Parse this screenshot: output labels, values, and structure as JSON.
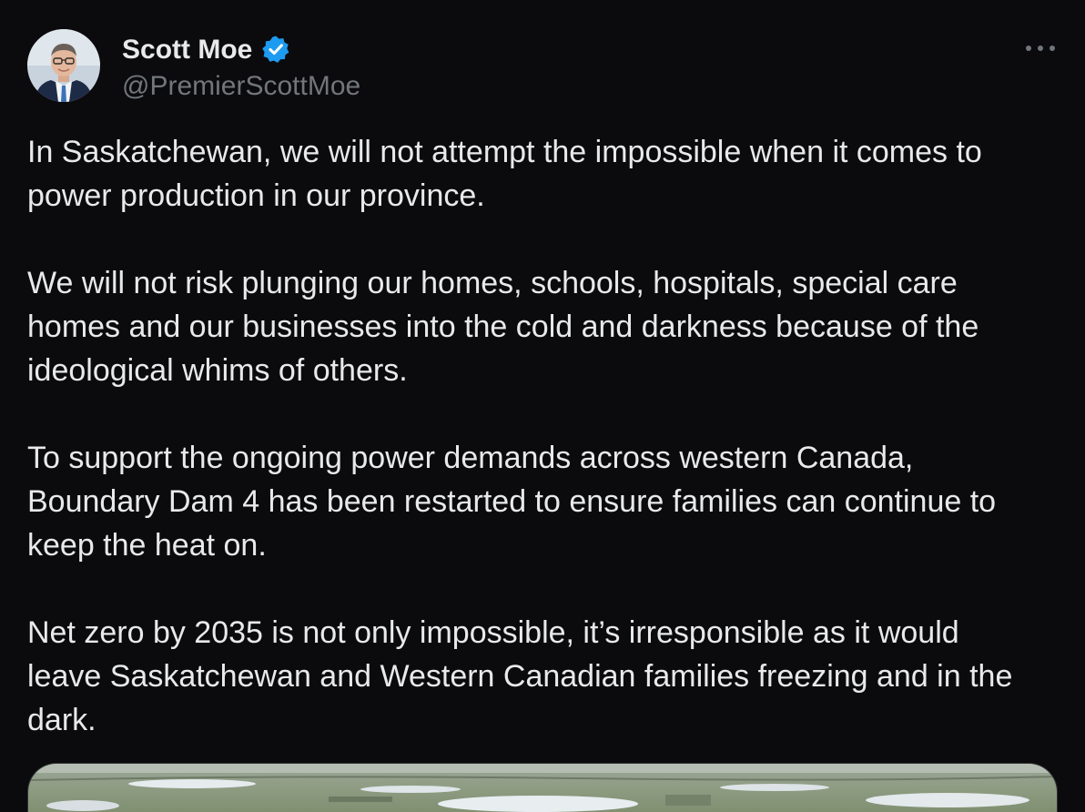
{
  "colors": {
    "background": "#0b0a0c",
    "text": "#e7e9ea",
    "secondary_text": "#71767b",
    "verified_blue": "#1d9bf0",
    "border": "#2f3336"
  },
  "tweet": {
    "author": {
      "name": "Scott Moe",
      "handle": "@PremierScottMoe",
      "verified": true,
      "avatar_icon": "avatar-photo",
      "badge_icon": "verified-badge-icon"
    },
    "more_icon": "more-options-icon",
    "paragraphs": [
      {
        "lines": [
          "In Saskatchewan, we will not attempt the impossible when it comes to",
          "power production in our province."
        ]
      },
      {
        "lines": [
          "We will not risk plunging our homes, schools, hospitals, special care",
          "homes and our businesses into the cold and darkness because of the",
          "ideological whims of others."
        ]
      },
      {
        "lines": [
          "To support the ongoing power demands across western Canada,",
          "Boundary Dam 4 has been restarted to ensure families can continue to",
          "keep the heat on."
        ]
      },
      {
        "lines": [
          "Net zero by 2035 is not only impossible, it’s irresponsible as it would",
          "leave Saskatchewan and Western Canadian families freezing and in the",
          "dark."
        ]
      }
    ],
    "media": {
      "type": "photo",
      "icon": "aerial-landscape-photo"
    }
  }
}
